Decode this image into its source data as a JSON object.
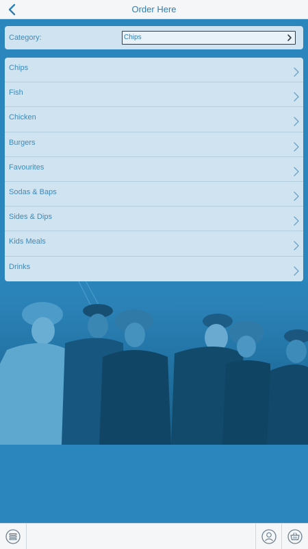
{
  "header": {
    "title": "Order Here",
    "back_icon": "chevron-left-icon"
  },
  "category": {
    "label": "Category:",
    "selected": "Chips"
  },
  "menu": {
    "items": [
      {
        "label": "Chips"
      },
      {
        "label": "Fish"
      },
      {
        "label": "Chicken"
      },
      {
        "label": "Burgers"
      },
      {
        "label": "Favourites"
      },
      {
        "label": "Sodas & Baps"
      },
      {
        "label": "Sides & Dips"
      },
      {
        "label": "Kids Meals"
      },
      {
        "label": "Drinks"
      }
    ]
  },
  "tabbar": {
    "menu_icon": "menu-list-icon",
    "account_icon": "user-icon",
    "basket_icon": "basket-icon"
  },
  "colors": {
    "background": "#2a86bd",
    "accent": "#2a7fb3",
    "card": "#cfe3f0",
    "bar": "#f4f6f8"
  }
}
